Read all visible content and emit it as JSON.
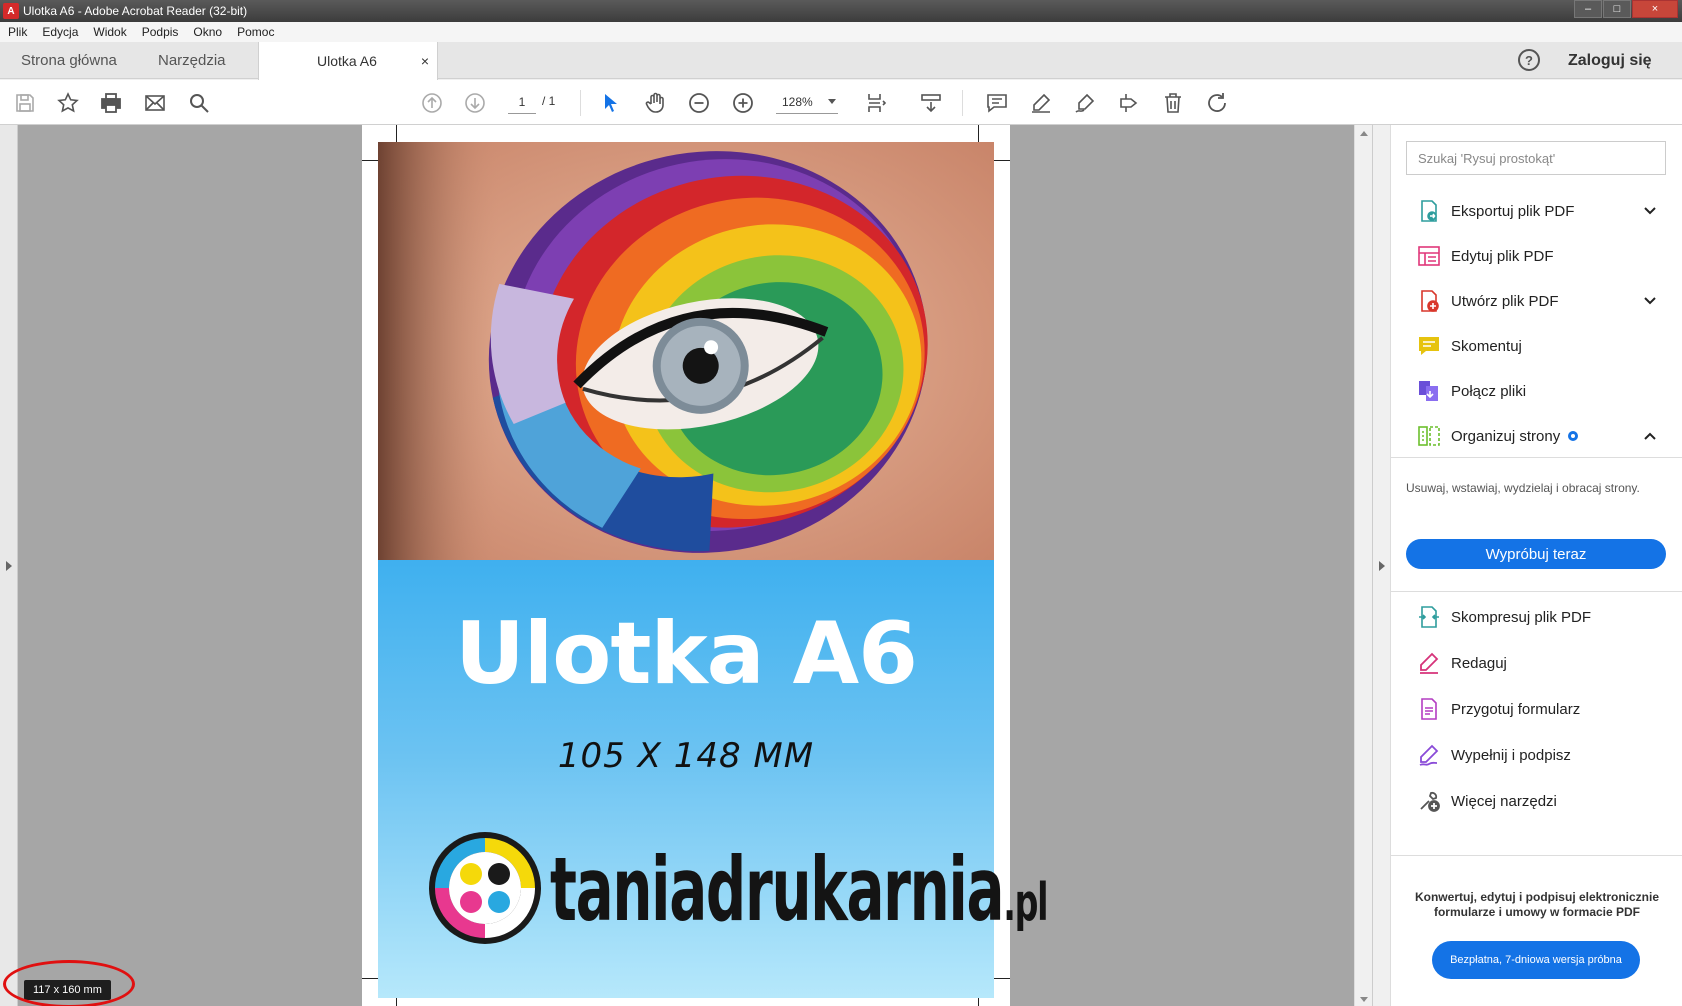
{
  "window": {
    "title": "Ulotka A6 - Adobe Acrobat Reader (32-bit)",
    "minimize": "–",
    "maximize": "□",
    "close": "×"
  },
  "menu": [
    "Plik",
    "Edycja",
    "Widok",
    "Podpis",
    "Okno",
    "Pomoc"
  ],
  "tabs": {
    "home": "Strona główna",
    "tools": "Narzędzia",
    "document": "Ulotka A6",
    "close": "×"
  },
  "header": {
    "help": "?",
    "login": "Zaloguj się"
  },
  "toolbar": {
    "page_current": "1",
    "page_total": "/ 1",
    "zoom": "128%"
  },
  "document": {
    "title": "Ulotka A6",
    "size": "105 X 148 MM",
    "brand": "taniadrukarnia",
    "brand_suffix": ".pl",
    "dimensions_badge": "117 x 160 mm"
  },
  "right_pane": {
    "search_placeholder": "Szukaj 'Rysuj prostokąt'",
    "tools_top": [
      {
        "label": "Eksportuj plik PDF",
        "icon": "export-pdf-icon",
        "color": "#2e9d9d",
        "expandable": true
      },
      {
        "label": "Edytuj plik PDF",
        "icon": "edit-pdf-icon",
        "color": "#e0377a",
        "expandable": false
      },
      {
        "label": "Utwórz plik PDF",
        "icon": "create-pdf-icon",
        "color": "#d9372b",
        "expandable": true
      },
      {
        "label": "Skomentuj",
        "icon": "comment-icon",
        "color": "#e6c30e",
        "expandable": false
      },
      {
        "label": "Połącz pliki",
        "icon": "combine-files-icon",
        "color": "#6a4fd8",
        "expandable": false
      },
      {
        "label": "Organizuj strony",
        "icon": "organize-pages-icon",
        "color": "#6cbf2d",
        "expanded": true
      }
    ],
    "organize_description": "Usuwaj, wstawiaj, wydzielaj i obracaj strony.",
    "try_button": "Wypróbuj teraz",
    "tools_bottom": [
      {
        "label": "Skompresuj plik PDF",
        "icon": "compress-pdf-icon",
        "color": "#2e9d9d"
      },
      {
        "label": "Redaguj",
        "icon": "redact-icon",
        "color": "#d6337a"
      },
      {
        "label": "Przygotuj formularz",
        "icon": "prepare-form-icon",
        "color": "#b43dc2"
      },
      {
        "label": "Wypełnij i podpisz",
        "icon": "fill-sign-icon",
        "color": "#8a4bd8"
      },
      {
        "label": "Więcej narzędzi",
        "icon": "more-tools-icon",
        "color": "#555555"
      }
    ],
    "promo_text": "Konwertuj, edytuj i podpisuj elektronicznie formularze i umowy w formacie PDF",
    "trial_button": "Bezpłatna, 7-dniowa wersja próbna"
  },
  "colors": {
    "accent": "#1473e6",
    "flyer_blue": "#3fb0ef",
    "annotation_ring": "#e01010"
  }
}
